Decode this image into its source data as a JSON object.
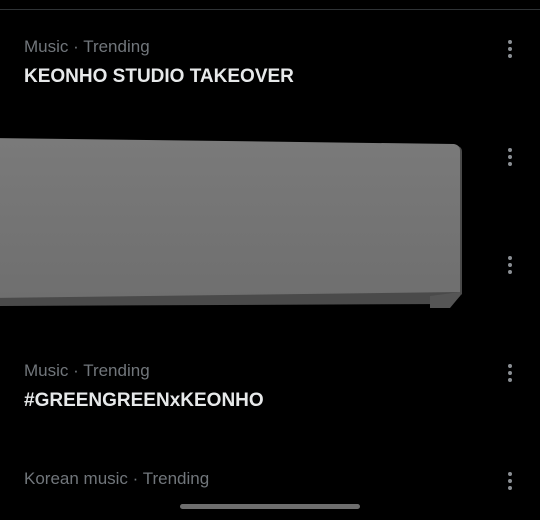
{
  "trends": [
    {
      "meta": "Music · Trending",
      "title": "KEONHO STUDIO TAKEOVER"
    },
    {
      "meta": "",
      "title": ""
    },
    {
      "meta": "",
      "title": ""
    },
    {
      "meta": "Music · Trending",
      "title": "#GREENGREENxKEONHO"
    },
    {
      "meta": "Korean music · Trending",
      "title": ""
    }
  ],
  "icons": {
    "more": "more-vertical-icon"
  },
  "colors": {
    "background": "#000000",
    "primary_text": "#e7e9ea",
    "secondary_text": "#71767b",
    "divider": "#2f3336",
    "overlay_gray": "#747474"
  }
}
